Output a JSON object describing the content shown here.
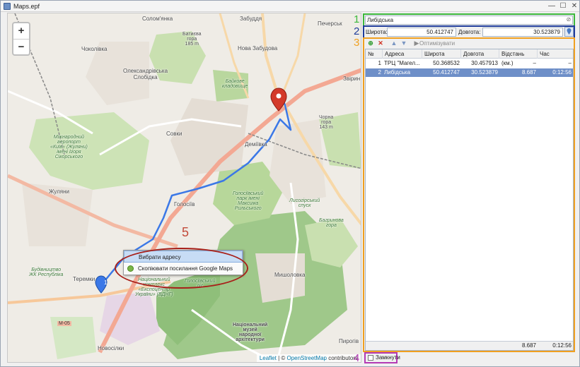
{
  "window": {
    "title": "Maps.epf",
    "minimize_glyph": "—",
    "maximize_glyph": "☐",
    "close_glyph": "✕"
  },
  "map": {
    "zoom_in": "+",
    "zoom_out": "−",
    "labels": {
      "solomianka": "Солом'янка",
      "zabuddya": "Забуддя",
      "pecherskyi": "Печерськ",
      "batyieva": "Батиєва\nгора\n185 m",
      "nova_zabudova": "Нова Забудова",
      "zvirynets": "Звірин",
      "chokolivka": "Чоколівка",
      "oleksandrivska": "Олександрівська\nСлобідка",
      "baikove": "Байкове\nкладовище",
      "chorna_hora": "Чорна\nгора\n143 m",
      "airport": "Міжнародний\nаеропорт\n«Київ» (Жуляни)\nімені Ігоря\nСікорського",
      "sovky": "Совки",
      "demiivka": "Деміївка",
      "zhuliany": "Жуляни",
      "holosiiv": "Голосіїв",
      "holosiivskyi_park": "Голосіївський\nпарк імені\nМаксима\nРильського",
      "lysohirskyi": "Лисогірський\nспуск",
      "bahrynova": "Багринова\nгора",
      "teremky": "Теремки",
      "budivnytstvo": "Будівництво\nЖК Республіка",
      "complex": "Національний\nкомплекс\n«Експоцентр\nУкраїни» (ВДНГ)",
      "holosiivskyi_lis": "Голосіївський\nліс",
      "myshelovka": "Мишоловка",
      "m05": "М-05",
      "novosilky": "Новосілки",
      "muzei": "Національний\nмузей\nнародної\nархітектури",
      "pyrohiv": "Пирогів"
    },
    "attribution": {
      "leaflet": "Leaflet",
      "sep": " | © ",
      "osm": "OpenStreetMap",
      "tail": " contributors"
    },
    "context_menu": {
      "items": [
        "Вибрати адресу",
        "Скопіювати посилання Google Maps"
      ]
    },
    "route_point_label": "1",
    "annotation_label": "5"
  },
  "search": {
    "value": "Либідська",
    "clear_glyph": "⊘"
  },
  "coords": {
    "lat_label": "Широта:",
    "lat_value": "50.412747",
    "lon_label": "Довгота:",
    "lon_value": "30.523879"
  },
  "toolbar": {
    "icons": [
      "add-icon",
      "delete-icon",
      "move-up-icon",
      "move-down-icon",
      "optimize-icon"
    ],
    "optimize_label": "Оптимізувати"
  },
  "grid": {
    "headers": [
      "№",
      "Адреса",
      "Широта",
      "Довгота",
      "Відстань (км.)",
      "Час"
    ],
    "rows": [
      {
        "n": "1",
        "address": "ТРЦ \"Магел...",
        "lat": "50.368532",
        "lon": "30.457913",
        "dist": "–",
        "time": "–"
      },
      {
        "n": "2",
        "address": "Либідська",
        "lat": "50.412747",
        "lon": "30.523879",
        "dist": "8.687",
        "time": "0:12:56"
      }
    ],
    "totals": {
      "dist": "8.687",
      "time": "0:12:56"
    }
  },
  "closed_checkbox": {
    "label": "Замкнути",
    "checked": false
  },
  "annotations": [
    "1",
    "2",
    "3",
    "4"
  ],
  "colors": {
    "annot1": "#3cb83c",
    "annot2": "#1f3c9b",
    "annot3": "#f0a020",
    "annot4": "#b43ab4",
    "route": "#3b78e7",
    "selection": "#6e8fc8"
  }
}
